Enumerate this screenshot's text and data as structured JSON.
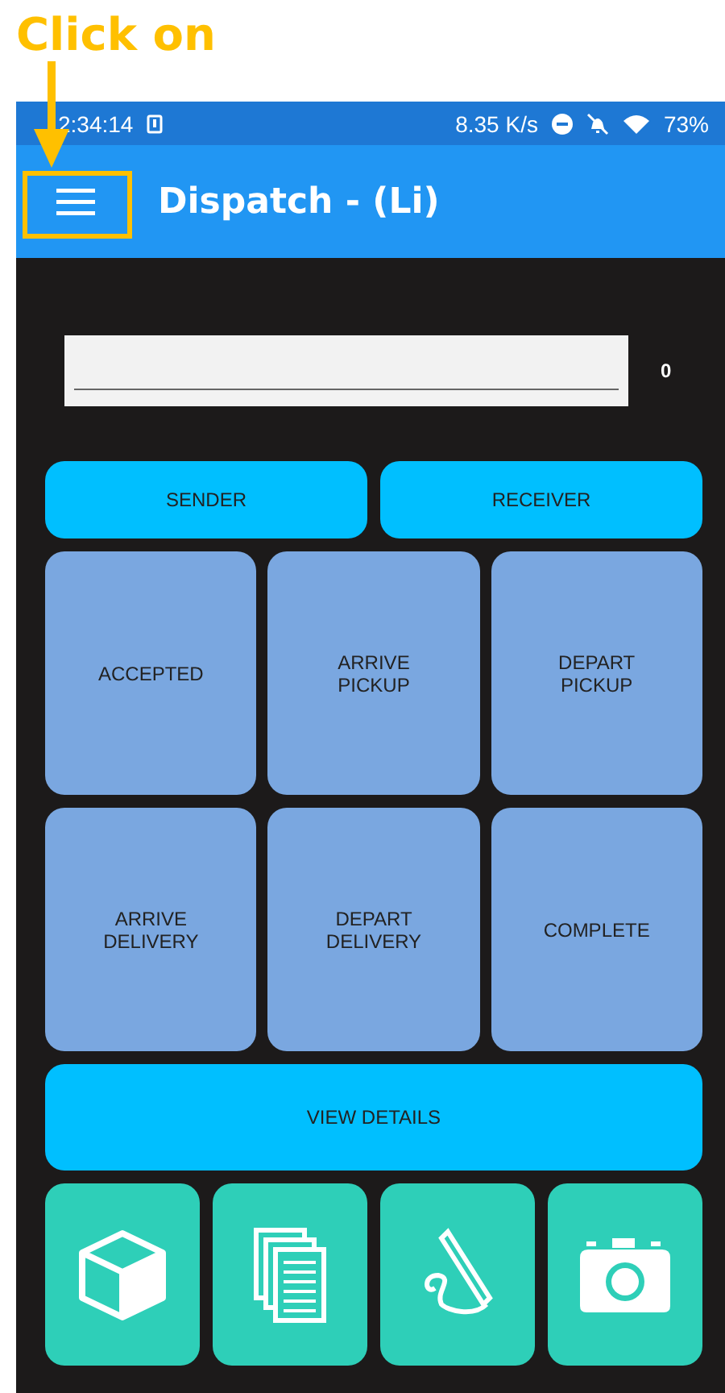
{
  "annotation": {
    "text": "Click on"
  },
  "status_bar": {
    "time": "2:34:14",
    "speed": "8.35 K/s",
    "battery": "73%"
  },
  "app_bar": {
    "title": "Dispatch - (Li)"
  },
  "entry": {
    "counter": "0"
  },
  "party_buttons": [
    "SENDER",
    "RECEIVER"
  ],
  "status_buttons": [
    "ACCEPTED",
    "ARRIVE\nPICKUP",
    "DEPART\nPICKUP",
    "ARRIVE\nDELIVERY",
    "DEPART\nDELIVERY",
    "COMPLETE"
  ],
  "details_button": "VIEW DETAILS",
  "tools": [
    {
      "kind": "box"
    },
    {
      "kind": "documents"
    },
    {
      "kind": "signature"
    },
    {
      "kind": "camera"
    }
  ]
}
